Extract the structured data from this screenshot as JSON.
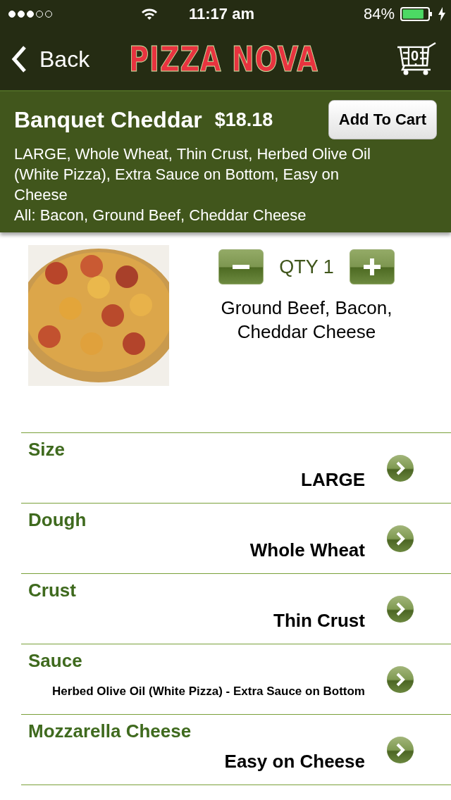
{
  "status_bar": {
    "time": "11:17 am",
    "battery": "84%",
    "charging": true
  },
  "nav": {
    "back": "Back",
    "logo": "PIZZA NOVA",
    "cart_count": "0"
  },
  "product": {
    "name": "Banquet Cheddar",
    "price": "$18.18",
    "add_button": "Add To Cart",
    "summary": "LARGE, Whole Wheat, Thin Crust, Herbed Olive Oil (White Pizza), Extra Sauce on Bottom, Easy on Cheese",
    "toppings_line": "All: Bacon, Ground Beef, Cheddar Cheese",
    "quantity": "QTY 1",
    "toppings": "Ground Beef, Bacon, Cheddar Cheese"
  },
  "options": [
    {
      "label": "Size",
      "value": "LARGE",
      "kind": "plain"
    },
    {
      "label": "Dough",
      "value": "Whole Wheat",
      "kind": "plain"
    },
    {
      "label": "Crust",
      "value": "Thin Crust",
      "kind": "plain"
    },
    {
      "label": "Sauce",
      "value": "Herbed Olive Oil (White Pizza) - Extra Sauce on Bottom",
      "kind": "compact"
    },
    {
      "label": "Mozzarella Cheese",
      "value": "Easy on Cheese",
      "kind": "plain"
    }
  ]
}
